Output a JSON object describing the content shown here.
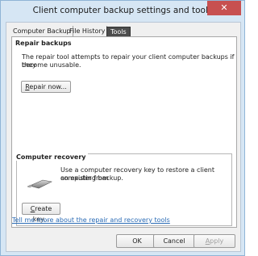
{
  "window": {
    "title": "Client computer backup settings and tools",
    "close_symbol": "✕"
  },
  "tabs": [
    {
      "label": "Computer Backup"
    },
    {
      "label": "File History"
    },
    {
      "label": "Tools"
    }
  ],
  "repair": {
    "heading": "Repair backups",
    "line1": "The repair tool attempts to repair your client computer backups if they",
    "line2": "become unusable.",
    "button_mnemonic": "R",
    "button_rest": "epair now..."
  },
  "recovery": {
    "heading": "Computer recovery",
    "line1": "Use a computer recovery key to restore a client computer from",
    "line2": "an existing backup.",
    "button_mnemonic": "C",
    "button_rest": "reate key..."
  },
  "help_link": "Tell me more about the repair and recovery tools",
  "footer": {
    "ok": "OK",
    "cancel": "Cancel",
    "apply_mnemonic": "A",
    "apply_rest": "pply"
  },
  "colors": {
    "accent_link": "#2a6bb5",
    "close_button": "#c75050",
    "active_tab": "#4d4d4d"
  }
}
